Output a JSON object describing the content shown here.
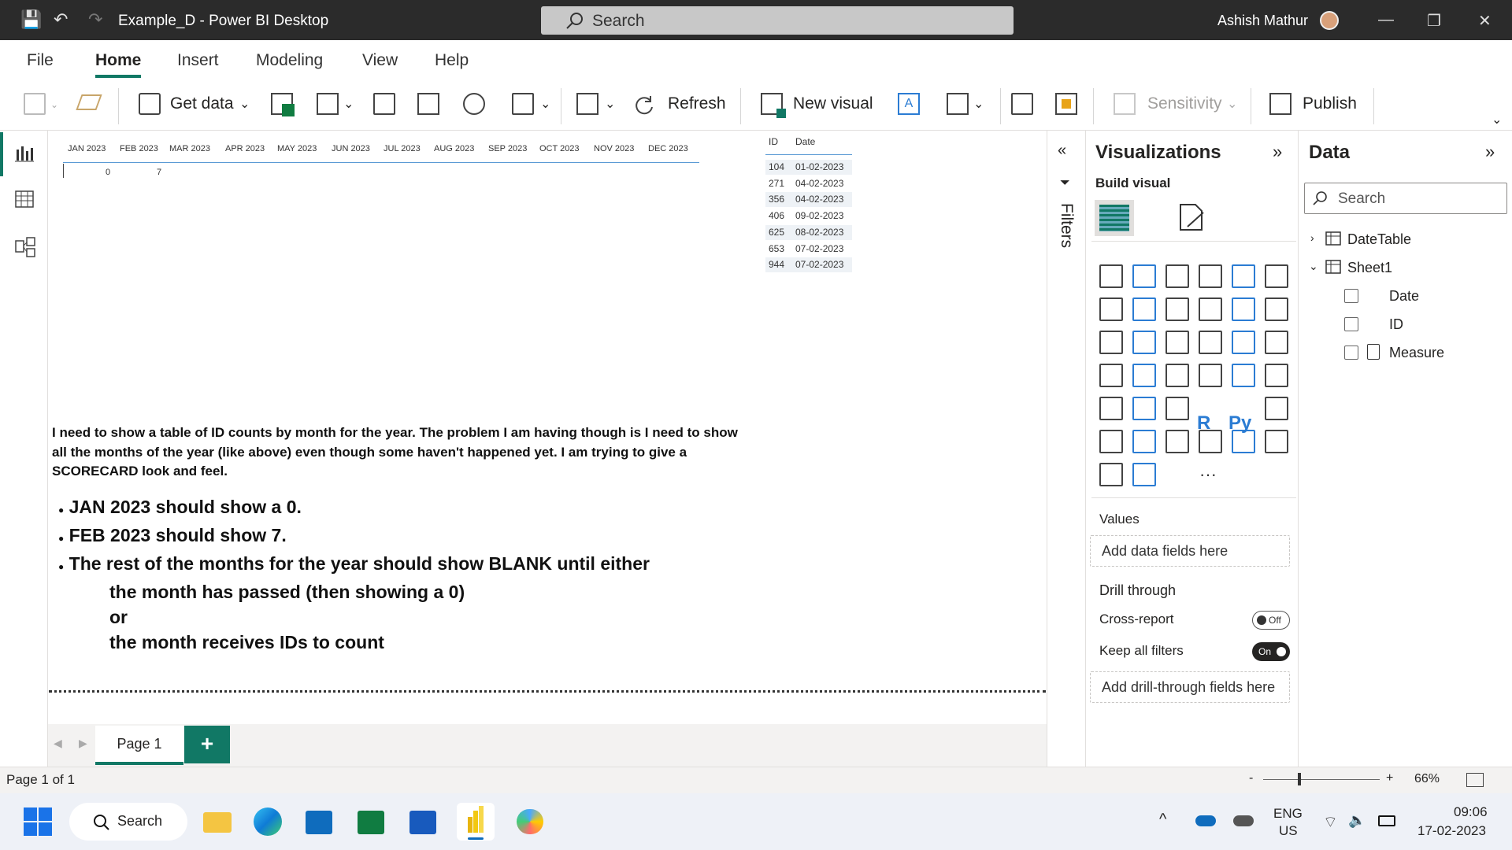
{
  "app": {
    "title": "Example_D - Power BI Desktop",
    "search_placeholder": "Search",
    "user": "Ashish Mathur"
  },
  "menu": [
    "File",
    "Home",
    "Insert",
    "Modeling",
    "View",
    "Help"
  ],
  "ribbon": {
    "get_data": "Get data",
    "refresh": "Refresh",
    "new_visual": "New visual",
    "sensitivity": "Sensitivity",
    "publish": "Publish"
  },
  "matrix": {
    "months": [
      "JAN 2023",
      "FEB 2023",
      "MAR 2023",
      "APR 2023",
      "MAY 2023",
      "JUN 2023",
      "JUL 2023",
      "AUG 2023",
      "SEP 2023",
      "OCT 2023",
      "NOV 2023",
      "DEC 2023"
    ],
    "values": [
      "0",
      "7"
    ]
  },
  "table": {
    "headers": [
      "ID",
      "Date"
    ],
    "rows": [
      [
        "104",
        "01-02-2023"
      ],
      [
        "271",
        "04-02-2023"
      ],
      [
        "356",
        "04-02-2023"
      ],
      [
        "406",
        "09-02-2023"
      ],
      [
        "625",
        "08-02-2023"
      ],
      [
        "653",
        "07-02-2023"
      ],
      [
        "944",
        "07-02-2023"
      ]
    ]
  },
  "note": {
    "para": "I need to show a table of ID counts by month for the year. The problem I am having though is I need to show all the months of the year (like above) even though some haven't happened yet. I am trying to give a SCORECARD look and feel.",
    "bullets": [
      "JAN 2023 should show a 0.",
      "FEB 2023 should show 7.",
      "The rest of the months for the year should show BLANK until either"
    ],
    "sub": [
      "the month has passed (then showing a 0)",
      "or",
      "the month receives IDs to count"
    ]
  },
  "filters": {
    "label": "Filters"
  },
  "viz": {
    "title": "Visualizations",
    "build": "Build visual",
    "values": "Values",
    "add_fields": "Add data fields here",
    "drill": "Drill through",
    "cross": "Cross-report",
    "cross_state": "Off",
    "keep": "Keep all filters",
    "keep_state": "On",
    "add_drill": "Add drill-through fields here",
    "more": "···",
    "r_label": "R",
    "py_label": "Py"
  },
  "data": {
    "title": "Data",
    "search": "Search",
    "tables": [
      "DateTable",
      "Sheet1"
    ],
    "fields": [
      "Date",
      "ID",
      "Measure"
    ]
  },
  "pages": {
    "tab": "Page 1",
    "status": "Page 1 of 1",
    "zoom": "66%"
  },
  "taskbar": {
    "search": "Search",
    "lang1": "ENG",
    "lang2": "US",
    "time": "09:06",
    "date": "17-02-2023"
  },
  "colors": {
    "accent": "#117865",
    "titlebar": "#2b2b2b",
    "yellow": "#f2c811"
  }
}
